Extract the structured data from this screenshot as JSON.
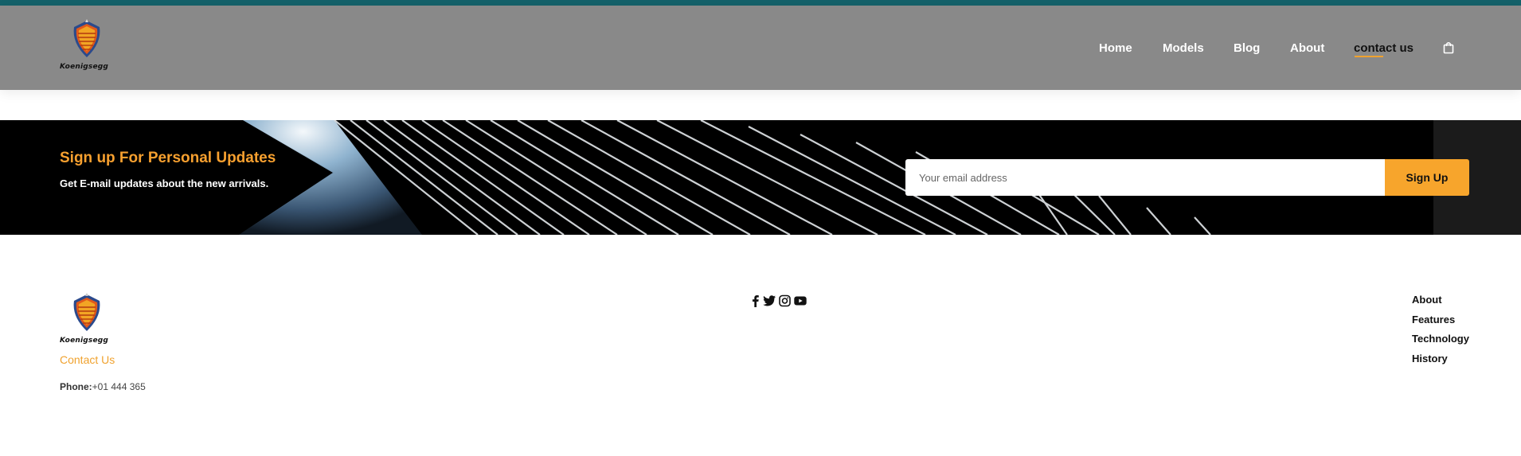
{
  "brand": {
    "logo_text": "Koenigsegg",
    "logo_icon": "shield-crest-icon"
  },
  "header": {
    "nav": [
      {
        "label": "Home"
      },
      {
        "label": "Models"
      },
      {
        "label": "Blog"
      },
      {
        "label": "About"
      },
      {
        "label": "contact us",
        "active": true
      }
    ],
    "cart_icon": "shopping-bag-icon"
  },
  "newsletter": {
    "title": "Sign up For Personal Updates",
    "subtitle": "Get E-mail updates about the new arrivals.",
    "email_placeholder": "Your email address",
    "button_label": "Sign Up"
  },
  "footer": {
    "contact_heading": "Contact Us",
    "phone_label": "Phone:",
    "phone_value": "+01 444 365",
    "social_icons": [
      "facebook-icon",
      "twitter-icon",
      "instagram-icon",
      "youtube-icon"
    ],
    "links": [
      {
        "label": "About"
      },
      {
        "label": "Features"
      },
      {
        "label": "Technology"
      },
      {
        "label": "History"
      }
    ]
  },
  "colors": {
    "top_bar": "#14616a",
    "header_bg": "#898989",
    "accent": "#f7a52c",
    "banner_bg": "#000000"
  }
}
